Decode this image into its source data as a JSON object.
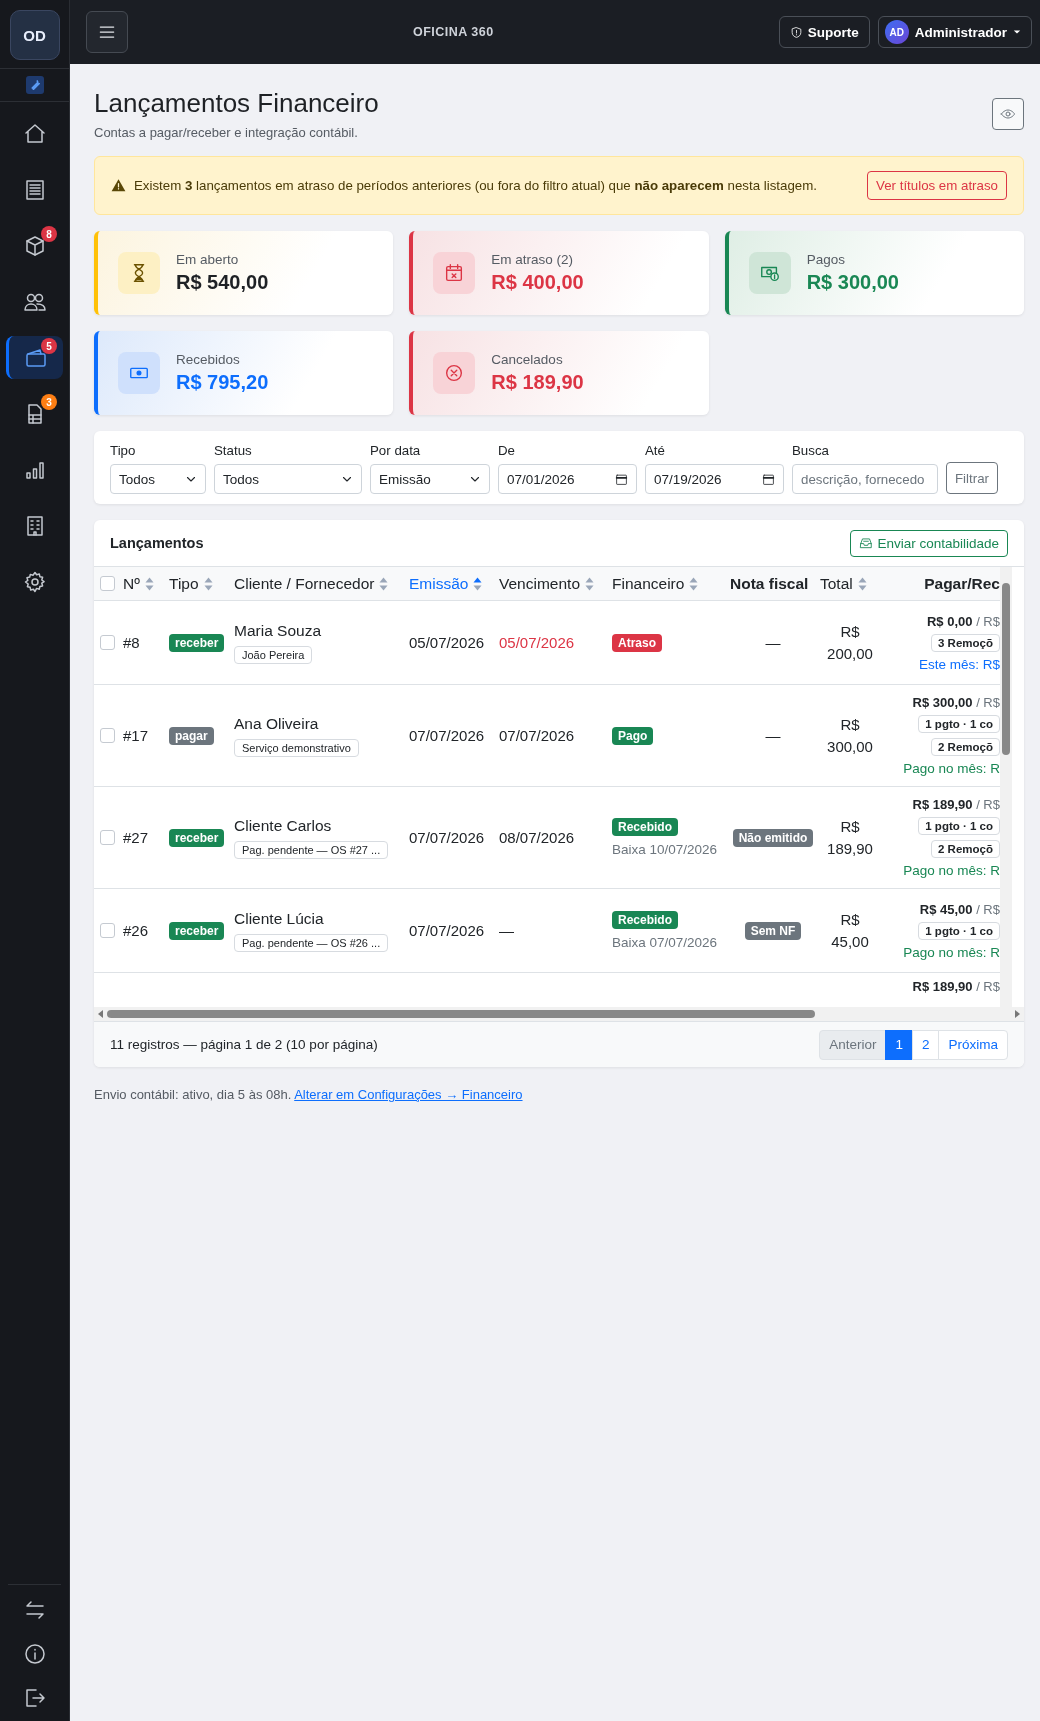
{
  "sidebar": {
    "logo": "OD",
    "items": [
      {
        "selected": false
      },
      {
        "selected": false
      },
      {
        "selected": false,
        "badge": "8",
        "color": "#dc3545"
      },
      {
        "selected": false
      },
      {
        "selected": true,
        "badge": "5",
        "color": "#dc3545"
      },
      {
        "selected": false,
        "badge": "3",
        "color": "#fd7e14"
      },
      {
        "selected": false
      },
      {
        "selected": false
      },
      {
        "selected": false
      }
    ]
  },
  "header": {
    "brand": "OFICINA 360",
    "support": "Suporte",
    "user_initials": "AD",
    "user": "Administrador"
  },
  "page": {
    "title": "Lançamentos Financeiro",
    "subtitle": "Contas a pagar/receber e integração contábil."
  },
  "alert": {
    "text": "Existem **3** lançamentos em atraso de períodos anteriores (ou fora do filtro atual) que **não aparecem** nesta listagem.",
    "button": "Ver títulos em atraso"
  },
  "cards": [
    {
      "kind": "warning",
      "label": "Em aberto",
      "value": "R$ 540,00"
    },
    {
      "kind": "danger",
      "label": "Em atraso (2)",
      "value": "R$ 400,00"
    },
    {
      "kind": "success",
      "label": "Pagos",
      "value": "R$ 300,00"
    },
    {
      "kind": "primary",
      "label": "Recebidos",
      "value": "R$ 795,20"
    },
    {
      "kind": "cancel",
      "label": "Cancelados",
      "value": "R$ 189,90"
    }
  ],
  "filters": [
    {
      "kind": "select",
      "label": "Tipo",
      "value": "Todos"
    },
    {
      "kind": "select",
      "label": "Status",
      "value": "Todos"
    },
    {
      "kind": "select",
      "label": "Por data",
      "value": "Emissão"
    },
    {
      "kind": "date",
      "label": "De",
      "value": "07/01/2026"
    },
    {
      "kind": "date",
      "label": "Até",
      "value": "07/19/2026"
    },
    {
      "kind": "search",
      "label": "Busca",
      "placeholder": "descrição, fornecedo"
    }
  ],
  "filter_button": "Filtrar",
  "table": {
    "title": "Lançamentos",
    "send_button": "Enviar contabilidade",
    "header_checked": false,
    "columns": [
      {
        "label": "Nº",
        "sortable": true,
        "sorted": false
      },
      {
        "label": "Tipo",
        "sortable": true,
        "sorted": false
      },
      {
        "label": "Cliente / Fornecedor",
        "sortable": true,
        "sorted": false
      },
      {
        "label": "Emissão",
        "sortable": true,
        "sorted": true
      },
      {
        "label": "Vencimento",
        "sortable": true,
        "sorted": false
      },
      {
        "label": "Financeiro",
        "sortable": true,
        "sorted": false
      },
      {
        "label": "Nota fiscal",
        "sortable": false,
        "sorted": false
      },
      {
        "label": "Total",
        "sortable": true,
        "sorted": false
      },
      {
        "label": "Pagar/Rec",
        "sortable": false,
        "sorted": false
      }
    ],
    "rows": [
      {
        "checked": false,
        "number": "#8",
        "type": {
          "kind": "receber",
          "text": "receber"
        },
        "client": "Maria Souza",
        "tag": "João Pereira",
        "issued": "05/07/2026",
        "due": "05/07/2026",
        "overdue": true,
        "status": {
          "kind": "atraso",
          "text": "Atraso"
        },
        "nota": {
          "kind": "dash",
          "text": "—"
        },
        "total": "R$ 200,00",
        "paid": "R$ 0,00",
        "of": "/ R$",
        "chips": [
          "3 Remoçõ"
        ],
        "note": {
          "kind": "month",
          "text": "Este mês: R$"
        }
      },
      {
        "checked": false,
        "number": "#17",
        "type": {
          "kind": "pagar",
          "text": "pagar"
        },
        "client": "Ana Oliveira",
        "tag": "Serviço demonstrativo",
        "issued": "07/07/2026",
        "due": "07/07/2026",
        "overdue": false,
        "status": {
          "kind": "pago",
          "text": "Pago"
        },
        "nota": {
          "kind": "dash",
          "text": "—"
        },
        "total": "R$ 300,00",
        "paid": "R$ 300,00",
        "of": "/ R$",
        "chips": [
          "1 pgto · 1 co",
          "2 Remoçõ"
        ],
        "note": {
          "kind": "paid",
          "text": "Pago no mês: R"
        }
      },
      {
        "checked": false,
        "number": "#27",
        "type": {
          "kind": "receber",
          "text": "receber"
        },
        "client": "Cliente Carlos",
        "tag": "Pag. pendente — OS #27 ...",
        "issued": "07/07/2026",
        "due": "08/07/2026",
        "overdue": false,
        "status": {
          "kind": "pago",
          "text": "Recebido"
        },
        "baixa": "Baixa 10/07/2026",
        "nota": {
          "kind": "badge",
          "text": "Não emitido"
        },
        "total": "R$ 189,90",
        "paid": "R$ 189,90",
        "of": "/ R$",
        "chips": [
          "1 pgto · 1 co",
          "2 Remoçõ"
        ],
        "note": {
          "kind": "paid",
          "text": "Pago no mês: R"
        }
      },
      {
        "checked": false,
        "number": "#26",
        "type": {
          "kind": "receber",
          "text": "receber"
        },
        "client": "Cliente Lúcia",
        "tag": "Pag. pendente — OS #26 ...",
        "issued": "07/07/2026",
        "due": "—",
        "overdue": false,
        "status": {
          "kind": "pago",
          "text": "Recebido"
        },
        "baixa": "Baixa 07/07/2026",
        "nota": {
          "kind": "badge",
          "text": "Sem NF"
        },
        "total": "R$ 45,00",
        "paid": "R$ 45,00",
        "of": "/ R$",
        "chips": [
          "1 pgto · 1 co"
        ],
        "note": {
          "kind": "paid",
          "text": "Pago no mês: R"
        }
      }
    ],
    "partial_row": {
      "paid": "R$ 189,90",
      "of": "/ R$"
    },
    "summary": "11 registros — página 1 de 2 (10 por página)",
    "pages": [
      {
        "label": "Anterior",
        "disabled": true,
        "selected": false
      },
      {
        "label": "1",
        "disabled": false,
        "selected": true
      },
      {
        "label": "2",
        "disabled": false,
        "selected": false
      },
      {
        "label": "Próxima",
        "disabled": false,
        "selected": false
      }
    ]
  },
  "footer": {
    "text": "Envio contábil: ativo, dia 5 às 08h.",
    "link": "Alterar em Configurações → Financeiro"
  }
}
